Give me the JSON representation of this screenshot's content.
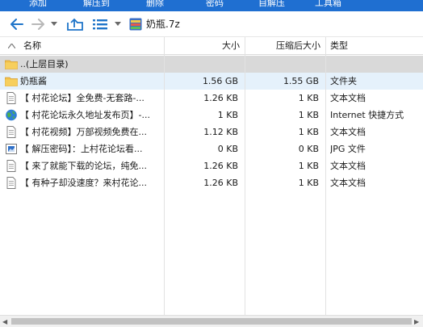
{
  "ribbon": {
    "items": [
      "添加",
      "解压到",
      "删除",
      "密码",
      "自解压",
      "工具箱"
    ]
  },
  "toolbar": {
    "path": "奶瓶.7z"
  },
  "columns": {
    "name": "名称",
    "size": "大小",
    "packed": "压缩后大小",
    "type": "类型"
  },
  "files": [
    {
      "name": "..(上层目录)",
      "size": "",
      "packed": "",
      "type": "",
      "icon": "folder-icon"
    },
    {
      "name": "奶瓶酱",
      "size": "1.56 GB",
      "packed": "1.55 GB",
      "type": "文件夹",
      "icon": "folder-icon"
    },
    {
      "name": "【 村花论坛】全免费-无套路-...",
      "size": "1.26 KB",
      "packed": "1 KB",
      "type": "文本文档",
      "icon": "text-file-icon"
    },
    {
      "name": "【 村花论坛永久地址发布页】-...",
      "size": "1 KB",
      "packed": "1 KB",
      "type": "Internet 快捷方式",
      "icon": "internet-shortcut-icon"
    },
    {
      "name": "【 村花视频】万部视频免费在...",
      "size": "1.12 KB",
      "packed": "1 KB",
      "type": "文本文档",
      "icon": "text-file-icon"
    },
    {
      "name": "【 解压密码】：上村花论坛看...",
      "size": "0 KB",
      "packed": "0 KB",
      "type": "JPG 文件",
      "icon": "image-file-icon"
    },
    {
      "name": "【 来了就能下载的论坛，纯免...",
      "size": "1.26 KB",
      "packed": "1 KB",
      "type": "文本文档",
      "icon": "text-file-icon"
    },
    {
      "name": "【 有种子却没速度？来村花论...",
      "size": "1.26 KB",
      "packed": "1 KB",
      "type": "文本文档",
      "icon": "text-file-icon"
    }
  ],
  "colors": {
    "ribbon": "#1f6fd1",
    "parent_row": "#d9d9d9",
    "selected_row": "#e5f1fb",
    "folder": "#f2c14a",
    "accent_icon": "#1e74c9"
  }
}
